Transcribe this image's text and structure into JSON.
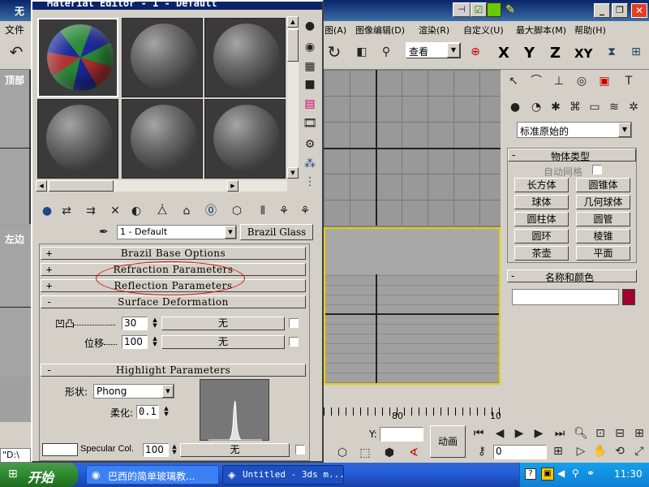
{
  "app": {
    "title_fragment": "无",
    "menu_left": "文件",
    "menus": [
      "图(A)",
      "图像编辑(D)",
      "渲染(R)",
      "自定义(U)",
      "最大脚本(M)",
      "帮助(H)"
    ],
    "view_dropdown": "查看",
    "axis_x": "X",
    "axis_y": "Y",
    "axis_z": "Z",
    "axis_xy": "XY",
    "viewport_top_label": "顶部",
    "viewport_left_label": "左边"
  },
  "material_editor": {
    "title": "Material Editor - 1 - Default",
    "material_name": "1 - Default",
    "material_type": "Brazil Glass",
    "rollouts": {
      "brazil_base": {
        "sign": "+",
        "label": "Brazil Base Options"
      },
      "refraction": {
        "sign": "+",
        "label": "Refraction Parameters"
      },
      "reflection": {
        "sign": "+",
        "label": "Reflection Parameters"
      },
      "surface": {
        "sign": "-",
        "label": "Surface Deformation"
      },
      "highlight": {
        "sign": "-",
        "label": "Highlight Parameters"
      }
    },
    "bump": {
      "label": "凹凸",
      "value": "30",
      "map": "无"
    },
    "displace": {
      "label": "位移",
      "value": "100",
      "map": "无"
    },
    "shape": {
      "label": "形状:",
      "value": "Phong"
    },
    "soften": {
      "label": "柔化:",
      "value": "0.1"
    },
    "specular": {
      "label": "Specular Col.",
      "value": "100",
      "map": "无"
    },
    "path_fragment": "\"D:\\"
  },
  "command_panel": {
    "dropdown": "标准原始的",
    "object_type_header": "物体类型",
    "autogrid": "自动网格",
    "buttons": [
      "长方体",
      "圆锥体",
      "球体",
      "几何球体",
      "圆柱体",
      "圆管",
      "圆环",
      "棱锥",
      "茶壶",
      "平面"
    ],
    "name_color_header": "名称和颜色",
    "object_color": "#a00030"
  },
  "viewport": {
    "tick_80": "80",
    "tick_100": "10"
  },
  "bottom": {
    "y_label": "Y:",
    "set_key": "动画",
    "frame_value": "0"
  },
  "taskbar": {
    "start": "开始",
    "task1": "巴西的简单玻璃教...",
    "task2": "Untitled - 3ds m...",
    "clock": "11:30"
  }
}
